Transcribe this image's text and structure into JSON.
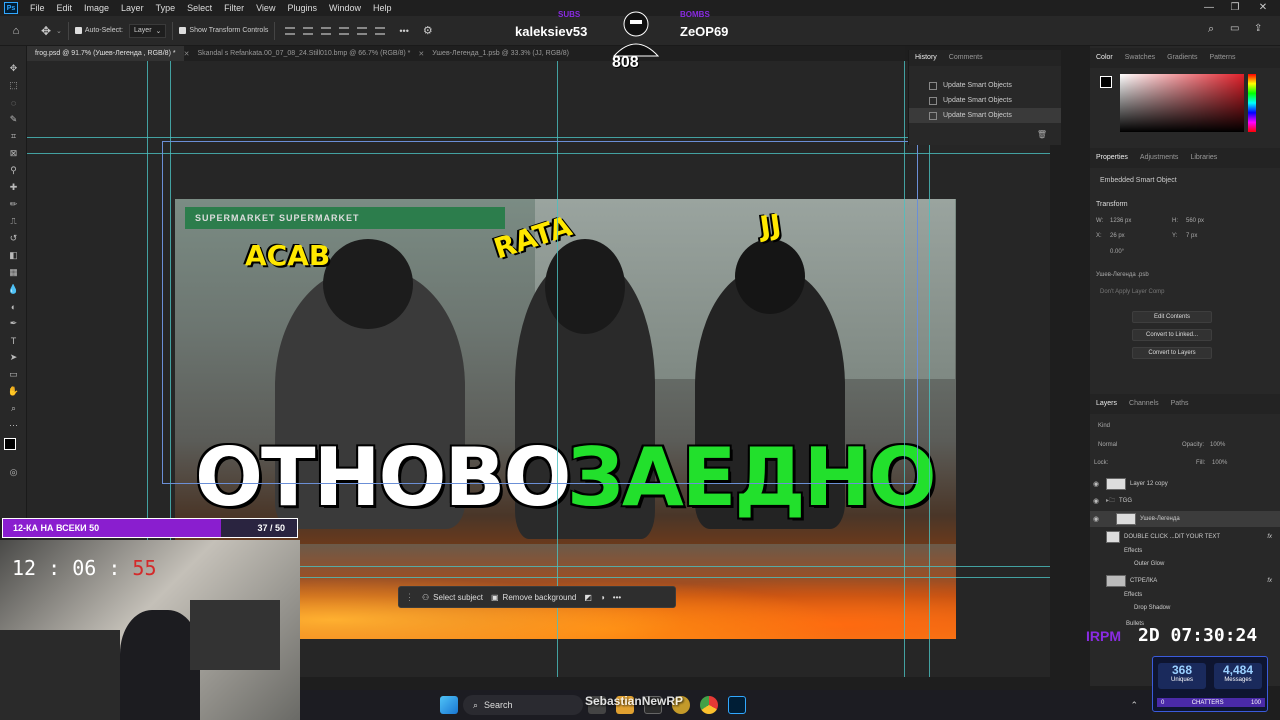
{
  "menubar": {
    "logo": "Ps",
    "items": [
      "File",
      "Edit",
      "Image",
      "Layer",
      "Type",
      "Select",
      "Filter",
      "View",
      "Plugins",
      "Window",
      "Help"
    ]
  },
  "options": {
    "auto_select_label": "Auto-Select:",
    "auto_select_value": "Layer",
    "show_transform_label": "Show Transform Controls",
    "more": "•••"
  },
  "stream_overlay": {
    "sub_tag": "SUBS",
    "sub_name": "kaleksiev53",
    "donor_tag": "BOMBS",
    "donor_name": "ZeOP69",
    "logo_text": "808",
    "goal_label": "12-КА НА ВСЕКИ 50",
    "goal_count": "37 / 50",
    "goal_progress": 0.74,
    "clock_hm": "12 : 06 :",
    "clock_s": "55",
    "timer_tag": "IRPM",
    "timer": "2D 07:30:24",
    "uniques": "368",
    "uniques_label": "Uniques",
    "messages": "4,484",
    "messages_label": "Messages",
    "chatters_label": "CHATTERS",
    "chatters_min": "0",
    "chatters_max": "100",
    "watermark": "SebastianNewRP"
  },
  "tabs": [
    {
      "label": "frog.psd @ 91.7% (Ушев-Легенда , RGB/8) *",
      "active": true
    },
    {
      "label": "Skandal s Refankata.00_07_08_24.Still010.bmp @ 66.7% (RGB/8) *",
      "active": false
    },
    {
      "label": "Ушев-Легенда_1.psb @ 33.3% (JJ, RGB/8)",
      "active": false
    }
  ],
  "artwork": {
    "title_white": "ОТНОВО",
    "title_green": "ЗАЕДНО",
    "name1": "ACAB",
    "name2": "RATA",
    "name3": "JJ",
    "sign": "SUPERMARKET  SUPERMARKET"
  },
  "context_bar": {
    "select_subject": "Select subject",
    "remove_background": "Remove background",
    "more": "•••"
  },
  "history": {
    "tabs": [
      "History",
      "Comments"
    ],
    "items": [
      "Update Smart Objects",
      "Update Smart Objects",
      "Update Smart Objects"
    ]
  },
  "color_panel": {
    "tabs": [
      "Color",
      "Swatches",
      "Gradients",
      "Patterns"
    ]
  },
  "properties": {
    "tabs": [
      "Properties",
      "Adjustments",
      "Libraries"
    ],
    "kind": "Embedded Smart Object",
    "transform_label": "Transform",
    "w_label": "W:",
    "w": "1236 px",
    "h_label": "H:",
    "h": "560 px",
    "x_label": "X:",
    "x": "26 px",
    "y_label": "Y:",
    "y": "7 px",
    "angle": "0.00°",
    "file": "Ушев-Легенда .psb",
    "comp": "Don't Apply Layer Comp",
    "buttons": [
      "Edit Contents",
      "Convert to Linked...",
      "Convert to Layers"
    ]
  },
  "layers": {
    "tabs": [
      "Layers",
      "Channels",
      "Paths"
    ],
    "filter": "Kind",
    "blend": "Normal",
    "opacity_label": "Opacity:",
    "opacity": "100%",
    "lock_label": "Lock:",
    "fill_label": "Fill:",
    "fill": "100%",
    "rows": [
      {
        "name": "Layer 12 copy"
      },
      {
        "name": "TGG"
      },
      {
        "name": "Ушев-Легенда"
      },
      {
        "name": "DOUBLE CLICK ...DIT YOUR TEXT"
      },
      {
        "name": "Effects"
      },
      {
        "name": "Outer Glow"
      },
      {
        "name": "СТРЕЛКА"
      },
      {
        "name": "Effects"
      },
      {
        "name": "Drop Shadow"
      },
      {
        "name": "Bullets"
      }
    ]
  },
  "taskbar": {
    "search": "Search"
  },
  "colors": {
    "accent": "#31a8ff",
    "guide": "#4bc0c0",
    "title_green": "#22e02c",
    "name_yellow": "#ffe800",
    "goal_purple": "#8a1ecf"
  }
}
